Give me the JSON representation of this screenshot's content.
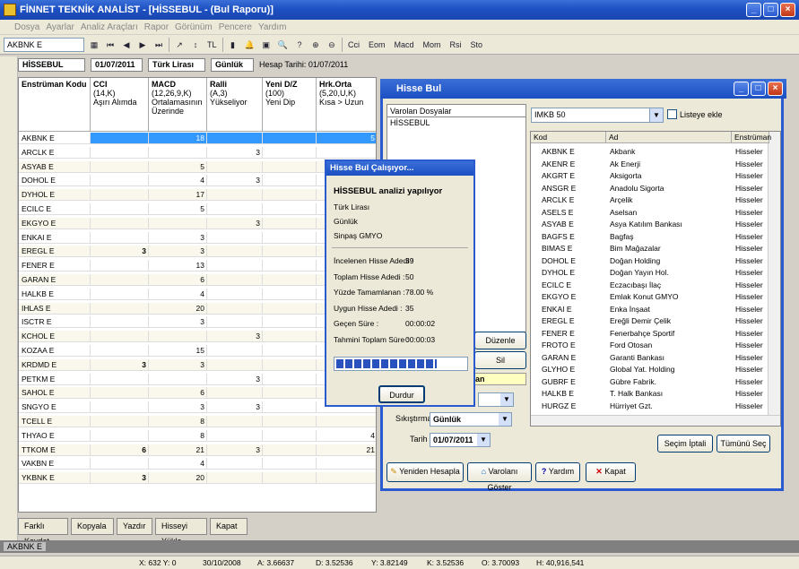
{
  "window": {
    "title": "FİNNET TEKNİK ANALİST - [HİSSEBUL - (Bul Raporu)]"
  },
  "menu": [
    "Dosya",
    "Ayarlar",
    "Analiz Araçları",
    "Rapor",
    "Görünüm",
    "Pencere",
    "Yardım"
  ],
  "toolbar": {
    "symbol": "AKBNK E",
    "tl": "TL",
    "buttons": [
      "Cci",
      "Eom",
      "Macd",
      "Mom",
      "Rsi",
      "Sto"
    ]
  },
  "header": {
    "name": "HİSSEBUL",
    "date": "01/07/2011",
    "currency": "Türk Lirası",
    "period": "Günlük",
    "calc_date": "Hesap Tarihi: 01/07/2011"
  },
  "grid": {
    "columns": [
      {
        "title": "Enstrüman Kodu",
        "sub": ""
      },
      {
        "title": "CCI",
        "sub": "(14,K)\nAşırı Alımda"
      },
      {
        "title": "MACD",
        "sub": "(12,26,9,K)\nOrtalamasının\nÜzerinde"
      },
      {
        "title": "Ralli",
        "sub": "(A,3)\nYükseliyor"
      },
      {
        "title": "Yeni D/Z",
        "sub": "(100)\nYeni Dip"
      },
      {
        "title": "Hrk.Orta",
        "sub": "(5,20,U,K)\nKısa > Uzun"
      }
    ],
    "rows": [
      [
        "AKBNK E",
        "",
        "18",
        "",
        "",
        "5"
      ],
      [
        "ARCLK E",
        "",
        "",
        "3",
        "",
        ""
      ],
      [
        "ASYAB E",
        "",
        "5",
        "",
        "",
        ""
      ],
      [
        "DOHOL E",
        "",
        "4",
        "3",
        "",
        ""
      ],
      [
        "DYHOL E",
        "",
        "17",
        "",
        "",
        ""
      ],
      [
        "ECILC E",
        "",
        "5",
        "",
        "",
        ""
      ],
      [
        "EKGYO E",
        "",
        "",
        "3",
        "",
        ""
      ],
      [
        "ENKAI E",
        "",
        "3",
        "",
        "",
        ""
      ],
      [
        "EREGL E",
        "3",
        "3",
        "",
        "",
        ""
      ],
      [
        "FENER E",
        "",
        "13",
        "",
        "",
        ""
      ],
      [
        "GARAN E",
        "",
        "6",
        "",
        "",
        ""
      ],
      [
        "HALKB E",
        "",
        "4",
        "",
        "",
        ""
      ],
      [
        "IHLAS E",
        "",
        "20",
        "",
        "",
        ""
      ],
      [
        "ISCTR E",
        "",
        "3",
        "",
        "",
        ""
      ],
      [
        "KCHOL E",
        "",
        "",
        "3",
        "",
        ""
      ],
      [
        "KOZAA E",
        "",
        "15",
        "",
        "",
        ""
      ],
      [
        "KRDMD E",
        "3",
        "3",
        "",
        "",
        ""
      ],
      [
        "PETKM E",
        "",
        "",
        "3",
        "",
        ""
      ],
      [
        "SAHOL E",
        "",
        "6",
        "",
        "",
        ""
      ],
      [
        "SNGYO E",
        "",
        "3",
        "3",
        "",
        ""
      ],
      [
        "TCELL E",
        "",
        "8",
        "",
        "",
        ""
      ],
      [
        "THYAO E",
        "",
        "8",
        "",
        "",
        "4"
      ],
      [
        "TTKOM E",
        "6",
        "21",
        "3",
        "",
        "21"
      ],
      [
        "VAKBN E",
        "",
        "4",
        "",
        "",
        ""
      ],
      [
        "YKBNK E",
        "3",
        "20",
        "",
        "",
        ""
      ]
    ]
  },
  "bottom_buttons": [
    "Farklı Kaydet",
    "Kopyala",
    "Yazdır",
    "Hisseyi Yükle",
    "Kapat"
  ],
  "active_symbol": "AKBNK E",
  "status": [
    "X: 632 Y: 0",
    "30/10/2008",
    "A: 3.66637",
    "D: 3.52536",
    "Y: 3.82149",
    "K: 3.52536",
    "O: 3.70093",
    "H: 40,916,541"
  ],
  "hissebul": {
    "title": "Hisse Bul",
    "existing_files_label": "Varolan Dosyalar",
    "existing_files": [
      "HİSSEBUL"
    ],
    "list_select": "IMKB 50",
    "add_to_list": "Listeye ekle",
    "list_headers": [
      "Kod",
      "Ad",
      "Enstrüman"
    ],
    "list": [
      [
        "AKBNK E",
        "Akbank",
        "Hisseler"
      ],
      [
        "AKENR E",
        "Ak Enerji",
        "Hisseler"
      ],
      [
        "AKGRT E",
        "Aksigorta",
        "Hisseler"
      ],
      [
        "ANSGR E",
        "Anadolu Sigorta",
        "Hisseler"
      ],
      [
        "ARCLK E",
        "Arçelik",
        "Hisseler"
      ],
      [
        "ASELS E",
        "Aselsan",
        "Hisseler"
      ],
      [
        "ASYAB E",
        "Asya Katılım Bankası",
        "Hisseler"
      ],
      [
        "BAGFS E",
        "Bagfaş",
        "Hisseler"
      ],
      [
        "BIMAS E",
        "Bim Mağazalar",
        "Hisseler"
      ],
      [
        "DOHOL E",
        "Doğan Holding",
        "Hisseler"
      ],
      [
        "DYHOL E",
        "Doğan Yayın Hol.",
        "Hisseler"
      ],
      [
        "ECILC E",
        "Eczacıbaşı İlaç",
        "Hisseler"
      ],
      [
        "EKGYO E",
        "Emlak Konut GMYO",
        "Hisseler"
      ],
      [
        "ENKAI E",
        "Enka İnşaat",
        "Hisseler"
      ],
      [
        "EREGL E",
        "Ereğli Demir Çelik",
        "Hisseler"
      ],
      [
        "FENER E",
        "Fenerbahçe Sportif",
        "Hisseler"
      ],
      [
        "FROTO E",
        "Ford Otosan",
        "Hisseler"
      ],
      [
        "GARAN E",
        "Garanti Bankası",
        "Hisseler"
      ],
      [
        "GLYHO E",
        "Global Yat. Holding",
        "Hisseler"
      ],
      [
        "GUBRF E",
        "Gübre Fabrik.",
        "Hisseler"
      ],
      [
        "HALKB E",
        "T. Halk Bankası",
        "Hisseler"
      ],
      [
        "HURGZ E",
        "Hürriyet Gzt.",
        "Hisseler"
      ]
    ],
    "edit_btn": "Düzenle",
    "delete_btn": "Sil",
    "yellow_label": "an",
    "compress_label": "Sıkıştırma :",
    "compress_value": "Günlük",
    "date_label": "Tarih :",
    "date_value": "01/07/2011",
    "select_cancel": "Seçim İptali",
    "select_all": "Tümünü Seç",
    "recalc": "Yeniden Hesapla",
    "show_existing": "Varolanı Göster",
    "help": "Yardım",
    "close": "Kapat"
  },
  "progress": {
    "title": "Hisse Bul Çalışıyor...",
    "heading": "HİSSEBUL analizi yapılıyor",
    "line1": "Türk Lirası",
    "line2": "Günlük",
    "line3": "Sinpaş GMYO",
    "stats": [
      [
        "İncelenen Hisse Adedi :",
        "39"
      ],
      [
        "Toplam Hisse Adedi :",
        "50"
      ],
      [
        "Yüzde Tamamlanan :",
        "78.00 %"
      ],
      [
        "Uygun Hisse Adedi :",
        "35"
      ],
      [
        "Geçen Süre :",
        "00:00:02"
      ],
      [
        "Tahmini Toplam Süre :",
        "00:00:03"
      ]
    ],
    "percent": 78,
    "stop": "Durdur"
  }
}
